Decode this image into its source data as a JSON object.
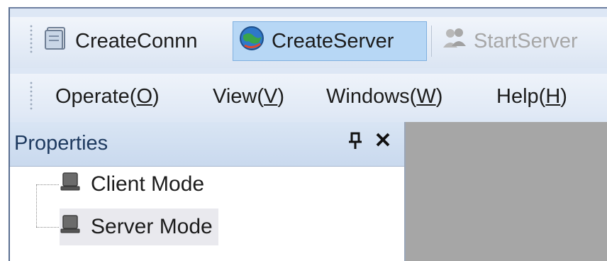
{
  "toolbar": {
    "create_conn_label": "CreateConnn",
    "create_server_label": "CreateServer",
    "start_server_label": "StartServer"
  },
  "menu": {
    "items": [
      {
        "label": "Operate(",
        "key": "O",
        "suffix": ")"
      },
      {
        "label": "View(",
        "key": "V",
        "suffix": ")"
      },
      {
        "label": "Windows(",
        "key": "W",
        "suffix": ")"
      },
      {
        "label": "Help(",
        "key": "H",
        "suffix": ")"
      }
    ]
  },
  "properties": {
    "title": "Properties",
    "pin_icon": "pin-icon",
    "close_icon": "close-icon",
    "tree": [
      {
        "label": "Client Mode",
        "icon": "device-icon",
        "selected": false
      },
      {
        "label": "Server Mode",
        "icon": "device-icon",
        "selected": true
      }
    ]
  },
  "colors": {
    "active_button": "#b7d7f5",
    "panel_header": "#d4e2f3",
    "content_area": "#a6a6a6"
  }
}
